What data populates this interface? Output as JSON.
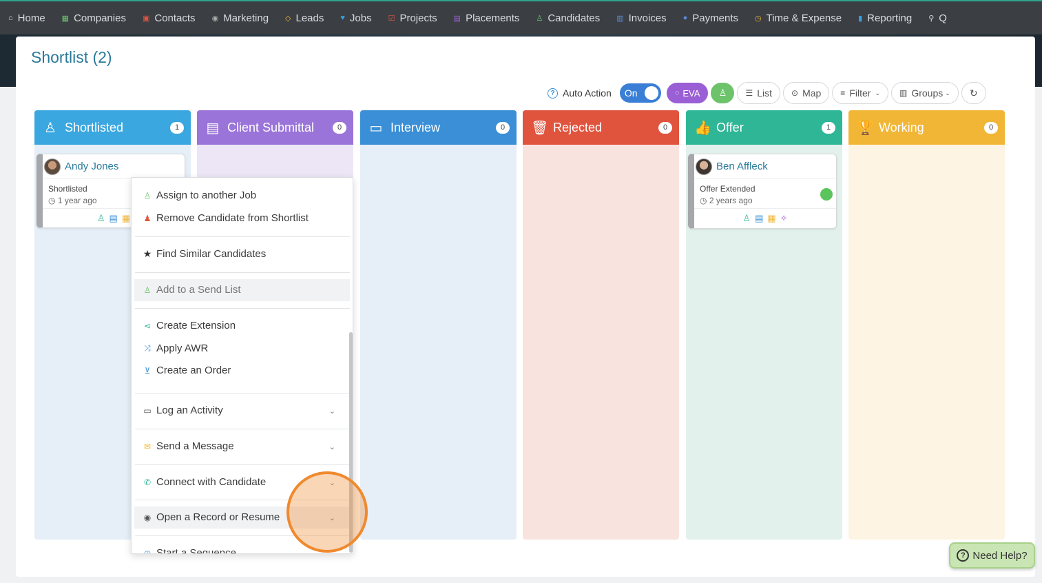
{
  "nav": {
    "items": [
      {
        "label": "Home",
        "icon": "home-icon",
        "glyph": "⌂",
        "color": "#d9dcdf"
      },
      {
        "label": "Companies",
        "icon": "building-icon",
        "glyph": "▦",
        "color": "#6cc36a"
      },
      {
        "label": "Contacts",
        "icon": "contact-card-icon",
        "glyph": "▣",
        "color": "#e0533d"
      },
      {
        "label": "Marketing",
        "icon": "broadcast-icon",
        "glyph": "◉",
        "color": "#aaaaaa"
      },
      {
        "label": "Leads",
        "icon": "diamond-icon",
        "glyph": "◇",
        "color": "#f2b636"
      },
      {
        "label": "Jobs",
        "icon": "trophy-icon",
        "glyph": "♥",
        "color": "#3aa0e0"
      },
      {
        "label": "Projects",
        "icon": "checkbox-icon",
        "glyph": "☑",
        "color": "#e0533d"
      },
      {
        "label": "Placements",
        "icon": "briefcase-icon",
        "glyph": "▤",
        "color": "#9a5fd4"
      },
      {
        "label": "Candidates",
        "icon": "user-icon",
        "glyph": "♙",
        "color": "#6cc36a"
      },
      {
        "label": "Invoices",
        "icon": "invoice-icon",
        "glyph": "▥",
        "color": "#5b8ad8"
      },
      {
        "label": "Payments",
        "icon": "coin-icon",
        "glyph": "●",
        "color": "#5b8ad8"
      },
      {
        "label": "Time & Expense",
        "icon": "clock-icon",
        "glyph": "◷",
        "color": "#f2b636"
      },
      {
        "label": "Reporting",
        "icon": "bar-chart-icon",
        "glyph": "▮",
        "color": "#3aa0e0"
      },
      {
        "label": "Q",
        "icon": "search-icon",
        "glyph": "⚲",
        "color": "#d9dcdf"
      }
    ]
  },
  "page": {
    "title": "Shortlist (2)"
  },
  "toolbar": {
    "auto_action": "Auto Action",
    "toggle": "On",
    "eva": "EVA",
    "list": "List",
    "map": "Map",
    "filter": "Filter",
    "groups": "Groups"
  },
  "columns": [
    {
      "label": "Shortlisted",
      "count": "1",
      "color": "#3aa7e0",
      "bg": "#e6eff8",
      "glyph": "♙"
    },
    {
      "label": "Client Submittal",
      "count": "0",
      "color": "#9a74d9",
      "bg": "#ece6f6",
      "glyph": "▤"
    },
    {
      "label": "Interview",
      "count": "0",
      "color": "#3a8fd6",
      "bg": "#e6eff8",
      "glyph": "▭"
    },
    {
      "label": "Rejected",
      "count": "0",
      "color": "#e0533d",
      "bg": "#f9e3df",
      "glyph": "🗑"
    },
    {
      "label": "Offer",
      "count": "1",
      "color": "#2fb696",
      "bg": "#e3f1ec",
      "glyph": "👍"
    },
    {
      "label": "Working",
      "count": "0",
      "color": "#f2b636",
      "bg": "#fdf4e3",
      "glyph": "🏆"
    }
  ],
  "cards": {
    "andy": {
      "name": "Andy Jones",
      "status": "Shortlisted",
      "time": "1 year ago"
    },
    "ben": {
      "name": "Ben Affleck",
      "status": "Offer Extended",
      "time": "2 years ago"
    }
  },
  "menu": {
    "assign": "Assign to another Job",
    "remove": "Remove Candidate from Shortlist",
    "find_similar": "Find Similar Candidates",
    "add_send_list": "Add to a Send List",
    "create_extension": "Create Extension",
    "apply_awr": "Apply AWR",
    "create_order": "Create an Order",
    "log_activity": "Log an Activity",
    "send_message": "Send a Message",
    "connect": "Connect with Candidate",
    "open_record": "Open a Record or Resume",
    "start_sequence": "Start a Sequence"
  },
  "help": {
    "label": "Need Help?"
  }
}
